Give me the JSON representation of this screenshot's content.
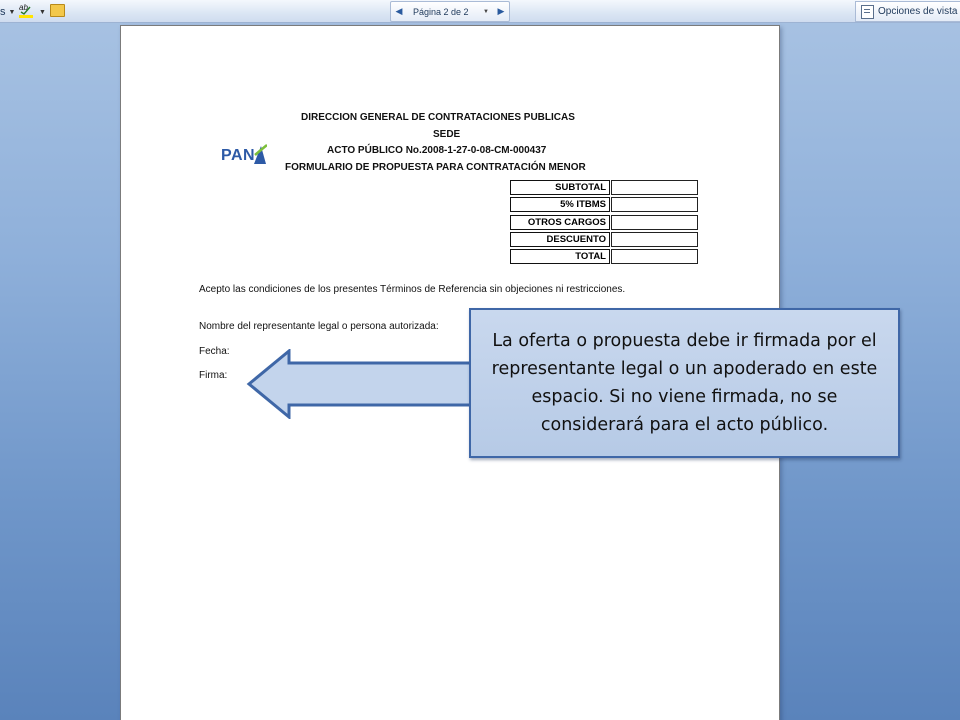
{
  "toolbar": {
    "left_fragment": "s",
    "spelling_icon": "spelling-grammar-icon",
    "folder_icon": "folder-icon",
    "pager": {
      "label": "Página 2 de 2",
      "prev_icon": "triangle-left-icon",
      "next_icon": "triangle-right-icon"
    },
    "view_options_label": "Opciones de vista"
  },
  "document": {
    "header_lines": [
      "DIRECCION GENERAL DE CONTRATACIONES PUBLICAS",
      "SEDE",
      "ACTO PÚBLICO No.2008-1-27-0-08-CM-000437",
      "FORMULARIO DE PROPUESTA PARA CONTRATACIÓN MENOR"
    ],
    "logo_text": "PAN",
    "totals_table": [
      {
        "label": "SUBTOTAL",
        "value": ""
      },
      {
        "label": "5% ITBMS",
        "value": ""
      },
      {
        "label": "OTROS CARGOS",
        "value": ""
      },
      {
        "label": "DESCUENTO",
        "value": ""
      },
      {
        "label": "TOTAL",
        "value": ""
      }
    ],
    "acceptance_text": "Acepto las condiciones de los presentes Términos de Referencia sin objeciones ni restricciones.",
    "representative_label": "Nombre del representante legal o persona autorizada:",
    "date_label": "Fecha:",
    "signature_label": "Firma:"
  },
  "callout": {
    "text": "La oferta o propuesta debe ir firmada por el representante legal o un apoderado en este espacio.   Si no viene firmada, no se considerará para el acto público.",
    "fill": "#c3d4ec",
    "border": "#3f67a7"
  }
}
